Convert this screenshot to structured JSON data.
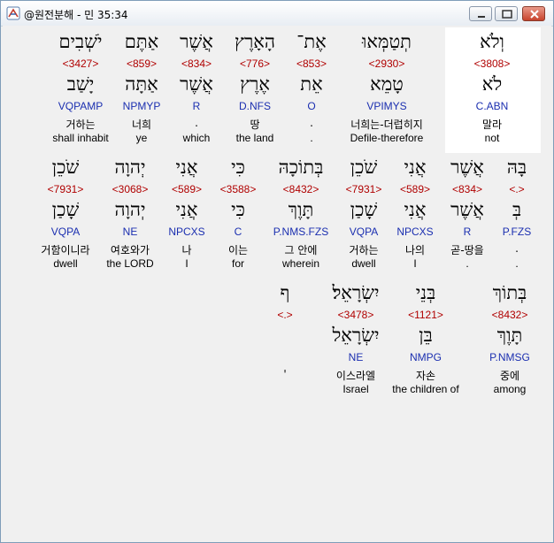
{
  "window": {
    "title": "@원전분해 - 민 35:34",
    "buttons": {
      "minimize": "minimize-icon",
      "maximize": "maximize-icon",
      "close": "close-icon"
    }
  },
  "colors": {
    "strong": "#b00000",
    "morph": "#1b2fb0",
    "highlight": "#ffffff"
  },
  "rows": [
    {
      "words": [
        {
          "heb": "וְלֹא",
          "strong": "<3808>",
          "lemma": "לֹא",
          "morph": "C.ABN",
          "kor": "말라",
          "eng": "not",
          "highlighted": true
        },
        {
          "heb": "תְטַמְּאוּ",
          "strong": "<2930>",
          "lemma": "טָמֵא",
          "morph": "VPIMYS",
          "kor": "너희는-더럽히지",
          "eng": "Defile-therefore"
        },
        {
          "heb": "אֶת־",
          "strong": "<853>",
          "lemma": "אֵת",
          "morph": "O",
          "kor": ".",
          "eng": "."
        },
        {
          "heb": "הָאָרֶץ",
          "strong": "<776>",
          "lemma": "אֶרֶץ",
          "morph": "D.NFS",
          "kor": "땅",
          "eng": "the land"
        },
        {
          "heb": "אֲשֶׁר",
          "strong": "<834>",
          "lemma": "אֲשֶׁר",
          "morph": "R",
          "kor": ".",
          "eng": "which"
        },
        {
          "heb": "אַתֶּם",
          "strong": "<859>",
          "lemma": "אַתָּה",
          "morph": "NPMYP",
          "kor": "너희",
          "eng": "ye"
        },
        {
          "heb": "יֹשְׁבִים",
          "strong": "<3427>",
          "lemma": "יָשַׁב",
          "morph": "VQPAMP",
          "kor": "거하는",
          "eng": "shall inhabit"
        }
      ]
    },
    {
      "words": [
        {
          "heb": "בָּהּ",
          "strong": "<.>",
          "lemma": "בְּ",
          "morph": "P.FZS",
          "kor": ".",
          "eng": "."
        },
        {
          "heb": "אֲשֶׁר",
          "strong": "<834>",
          "lemma": "אֲשֶׁר",
          "morph": "R",
          "kor": "곧-땅을",
          "eng": "."
        },
        {
          "heb": "אֲנִי",
          "strong": "<589>",
          "lemma": "אֲנִי",
          "morph": "NPCXS",
          "kor": "나의",
          "eng": "I"
        },
        {
          "heb": "שֹׁכֵן",
          "strong": "<7931>",
          "lemma": "שָׁכַן",
          "morph": "VQPA",
          "kor": "거하는",
          "eng": "dwell"
        },
        {
          "heb": "בְּתוֹכָהּ",
          "strong": "<8432>",
          "lemma": "תָּוֶךְ",
          "morph": "P.NMS.FZS",
          "kor": "그 안에",
          "eng": "wherein"
        },
        {
          "heb": "כִּי",
          "strong": "<3588>",
          "lemma": "כִּי",
          "morph": "C",
          "kor": "이는",
          "eng": "for"
        },
        {
          "heb": "אֲנִי",
          "strong": "<589>",
          "lemma": "אֲנִי",
          "morph": "NPCXS",
          "kor": "나",
          "eng": "I"
        },
        {
          "heb": "יְהוָה",
          "strong": "<3068>",
          "lemma": "יְהוָה",
          "morph": "NE",
          "kor": "여호와가",
          "eng": "the LORD"
        },
        {
          "heb": "שֹׁכֵן",
          "strong": "<7931>",
          "lemma": "שָׁכַן",
          "morph": "VQPA",
          "kor": "거함이니라",
          "eng": "dwell"
        }
      ]
    },
    {
      "words": [
        {
          "heb": "בְּתוֹךְ",
          "strong": "<8432>",
          "lemma": "תָּוֶךְ",
          "morph": "P.NMSG",
          "kor": "중에",
          "eng": "among"
        },
        {
          "heb": "בְּנֵי",
          "strong": "<1121>",
          "lemma": "בֵּן",
          "morph": "NMPG",
          "kor": "자손",
          "eng": "the children of"
        },
        {
          "heb": "יִשְׂרָאֵל׃",
          "strong": "<3478>",
          "lemma": "יִשְׂרָאֵל",
          "morph": "NE",
          "kor": "이스라엘",
          "eng": "Israel"
        },
        {
          "heb": "ף",
          "strong": "<.>",
          "lemma": "",
          "morph": "",
          "kor": "'",
          "eng": ""
        }
      ]
    }
  ]
}
